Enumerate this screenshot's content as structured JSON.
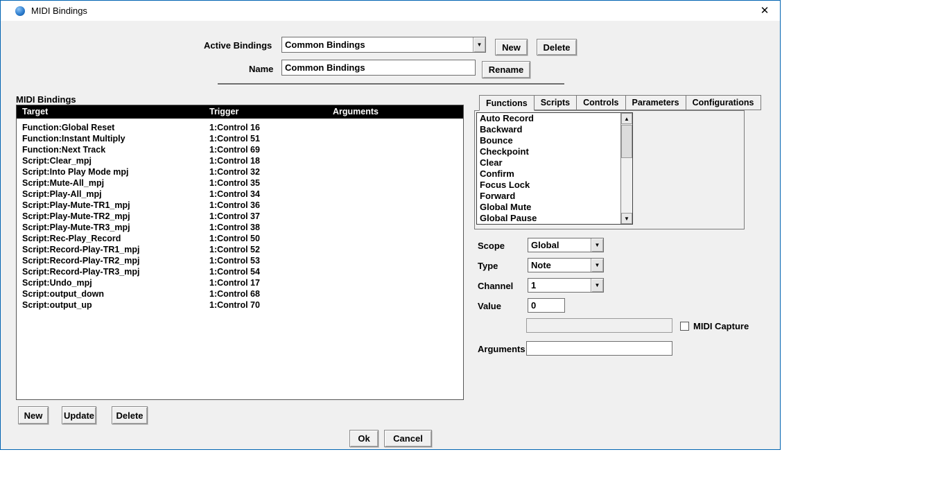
{
  "window": {
    "title": "MIDI Bindings",
    "close_icon": "✕"
  },
  "header": {
    "active_bindings_label": "Active Bindings",
    "active_bindings_value": "Common Bindings",
    "new_button": "New",
    "delete_button": "Delete",
    "name_label": "Name",
    "name_value": "Common Bindings",
    "rename_button": "Rename"
  },
  "bindings": {
    "section_label": "MIDI Bindings",
    "columns": {
      "target": "Target",
      "trigger": "Trigger",
      "arguments": "Arguments"
    },
    "rows": [
      {
        "target": "Function:Global Reset",
        "trigger": "1:Control 16",
        "arguments": ""
      },
      {
        "target": "Function:Instant Multiply",
        "trigger": "1:Control 51",
        "arguments": ""
      },
      {
        "target": "Function:Next Track",
        "trigger": "1:Control 69",
        "arguments": ""
      },
      {
        "target": "Script:Clear_mpj",
        "trigger": "1:Control 18",
        "arguments": ""
      },
      {
        "target": "Script:Into Play Mode mpj",
        "trigger": "1:Control 32",
        "arguments": ""
      },
      {
        "target": "Script:Mute-All_mpj",
        "trigger": "1:Control 35",
        "arguments": ""
      },
      {
        "target": "Script:Play-All_mpj",
        "trigger": "1:Control 34",
        "arguments": ""
      },
      {
        "target": "Script:Play-Mute-TR1_mpj",
        "trigger": "1:Control 36",
        "arguments": ""
      },
      {
        "target": "Script:Play-Mute-TR2_mpj",
        "trigger": "1:Control 37",
        "arguments": ""
      },
      {
        "target": "Script:Play-Mute-TR3_mpj",
        "trigger": "1:Control 38",
        "arguments": ""
      },
      {
        "target": "Script:Rec-Play_Record",
        "trigger": "1:Control 50",
        "arguments": ""
      },
      {
        "target": "Script:Record-Play-TR1_mpj",
        "trigger": "1:Control 52",
        "arguments": ""
      },
      {
        "target": "Script:Record-Play-TR2_mpj",
        "trigger": "1:Control 53",
        "arguments": ""
      },
      {
        "target": "Script:Record-Play-TR3_mpj",
        "trigger": "1:Control 54",
        "arguments": ""
      },
      {
        "target": "Script:Undo_mpj",
        "trigger": "1:Control 17",
        "arguments": ""
      },
      {
        "target": "Script:output_down",
        "trigger": "1:Control 68",
        "arguments": ""
      },
      {
        "target": "Script:output_up",
        "trigger": "1:Control 70",
        "arguments": ""
      }
    ],
    "new_button": "New",
    "update_button": "Update",
    "delete_button": "Delete"
  },
  "right": {
    "tabs": [
      "Functions",
      "Scripts",
      "Controls",
      "Parameters",
      "Configurations"
    ],
    "active_tab": "Functions",
    "functions_list": [
      "Auto Record",
      "Backward",
      "Bounce",
      "Checkpoint",
      "Clear",
      "Confirm",
      "Focus Lock",
      "Forward",
      "Global Mute",
      "Global Pause"
    ],
    "scope_label": "Scope",
    "scope_value": "Global",
    "type_label": "Type",
    "type_value": "Note",
    "channel_label": "Channel",
    "channel_value": "1",
    "value_label": "Value",
    "value_value": "0",
    "capture_value": "",
    "midi_capture_label": "MIDI Capture",
    "midi_capture_checked": false,
    "arguments_label": "Arguments",
    "arguments_value": ""
  },
  "footer": {
    "ok_button": "Ok",
    "cancel_button": "Cancel"
  },
  "icons": {
    "dropdown_arrow": "▼",
    "scroll_up": "▲",
    "scroll_down": "▼"
  },
  "colors": {
    "window_border": "#0063b1",
    "table_header_bg": "#000000",
    "body_bg": "#f0f0f0"
  }
}
